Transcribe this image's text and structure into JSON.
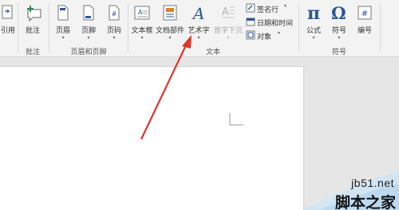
{
  "ribbon": {
    "partial_left": {
      "label": "引用"
    },
    "comments": {
      "comment_button": "批注",
      "group_label": "批注"
    },
    "header_footer": {
      "header_button": "页眉",
      "footer_button": "页脚",
      "page_number_button": "页码",
      "group_label": "页眉和页脚"
    },
    "text": {
      "textbox_button": "文本框",
      "quickparts_button": "文档部件",
      "wordart_button": "艺术字",
      "dropcap_button": "首字下沉",
      "signature_line": "签名行",
      "date_time": "日期和时间",
      "object": "对象",
      "group_label": "文本"
    },
    "symbols": {
      "equation_button": "公式",
      "symbol_button": "符号",
      "number_button": "编号",
      "group_label": "符号"
    }
  },
  "watermark": {
    "site": "jb51.net",
    "name": "脚本之家"
  },
  "colors": {
    "ribbon_bg": "#f3f3f3",
    "blue_accent": "#2b579a",
    "arrow_red": "#e5322d"
  }
}
